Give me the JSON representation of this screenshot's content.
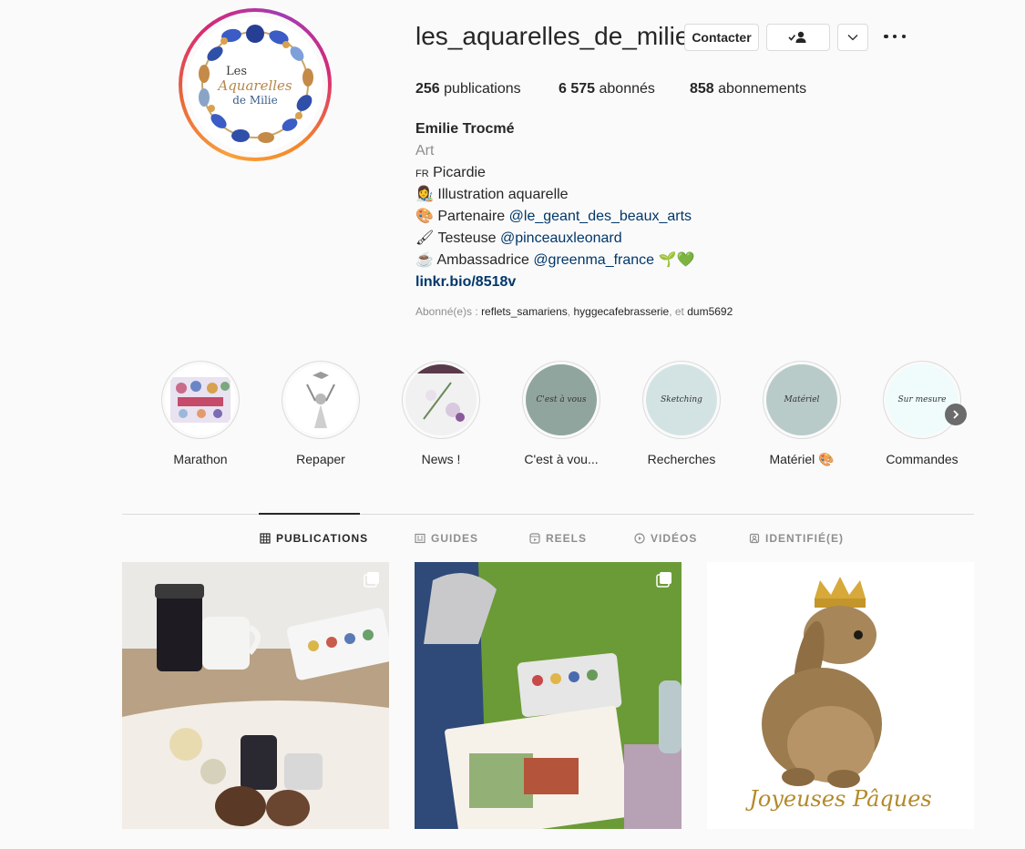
{
  "profile": {
    "username": "les_aquarelles_de_milie",
    "avatar_text": [
      "Les",
      "Aquarelles",
      "de Milie"
    ],
    "contact_label": "Contacter",
    "stats": {
      "posts_count": "256",
      "posts_label": "publications",
      "followers_count": "6 575",
      "followers_label": "abonnés",
      "following_count": "858",
      "following_label": "abonnements"
    },
    "bio": {
      "name": "Emilie Trocmé",
      "category": "Art",
      "line1_flag": "FR",
      "line1_text": "Picardie",
      "line2_emoji": "👩‍🎨",
      "line2_text": "Illustration aquarelle",
      "line3_emoji": "🎨",
      "line3_text": "Partenaire",
      "line3_mention": "@le_geant_des_beaux_arts",
      "line4_emoji": "🖌",
      "line4_text": "Testeuse",
      "line4_mention": "@pinceauxleonard",
      "line5_emoji": "☕",
      "line5_text": "Ambassadrice",
      "line5_mention": "@greenma_france",
      "line5_trailing": "🌱💚",
      "website": "linkr.bio/8518v"
    },
    "followed_by": {
      "prefix": "Abonné(e)s :",
      "user1": "reflets_samariens",
      "sep1": ",",
      "user2": "hyggecafebrasserie",
      "sep2": ", et",
      "user3": "dum5692"
    }
  },
  "highlights": [
    {
      "label": "Marathon"
    },
    {
      "label": "Repaper"
    },
    {
      "label": "News !"
    },
    {
      "label": "C'est à vou...",
      "cover_text": "C'est à vous",
      "cover_color": "#91a59f"
    },
    {
      "label": "Recherches",
      "cover_text": "Sketching",
      "cover_color": "#d3e3e3"
    },
    {
      "label": "Matériel 🎨",
      "cover_text": "Matériel",
      "cover_color": "#b9cbc9"
    },
    {
      "label": "Commandes",
      "cover_text": "Sur mesure",
      "cover_color": "#effcfb"
    }
  ],
  "tabs": [
    {
      "label": "PUBLICATIONS",
      "icon": "grid-icon",
      "active": true
    },
    {
      "label": "GUIDES",
      "icon": "guide-icon"
    },
    {
      "label": "REELS",
      "icon": "reels-icon"
    },
    {
      "label": "VIDÉOS",
      "icon": "play-icon"
    },
    {
      "label": "IDENTIFIÉ(E)",
      "icon": "tag-icon"
    }
  ],
  "posts": [
    {
      "multi": true
    },
    {
      "multi": true
    },
    {
      "multi": false,
      "caption": "Joyeuses Pâques"
    }
  ]
}
